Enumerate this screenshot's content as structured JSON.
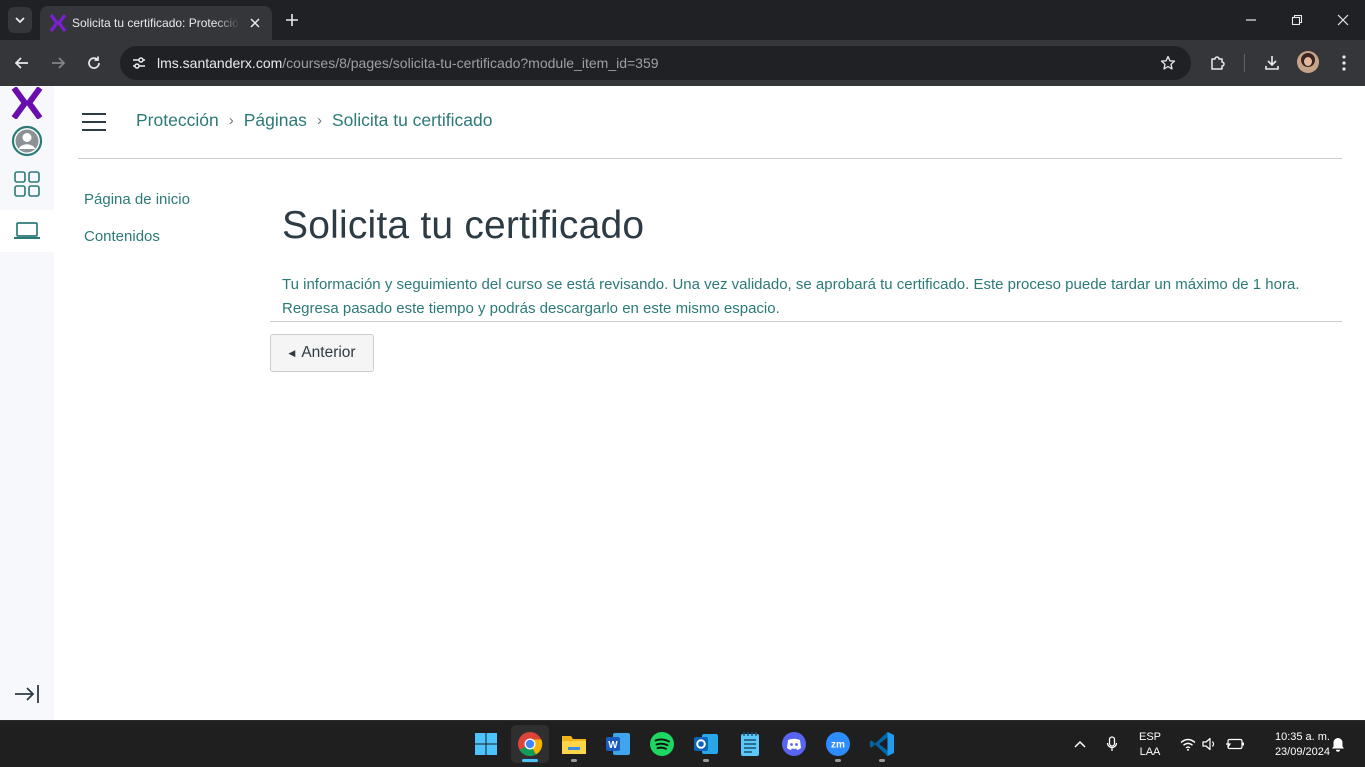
{
  "browser": {
    "tab": {
      "title": "Solicita tu certificado: Protección"
    },
    "url": {
      "host": "lms.santanderx.com",
      "path": "/courses/8/pages/solicita-tu-certificado?module_item_id=359"
    }
  },
  "lms": {
    "breadcrumb": [
      {
        "label": "Protección"
      },
      {
        "label": "Páginas"
      },
      {
        "label": "Solicita tu certificado"
      }
    ],
    "course_nav": [
      {
        "label": "Página de inicio"
      },
      {
        "label": "Contenidos"
      }
    ],
    "page": {
      "title": "Solicita tu certificado",
      "body": "Tu información y seguimiento del curso se está revisando. Una vez validado, se aprobará tu certificado. Este proceso puede tardar un máximo de 1 hora. Regresa pasado este tiempo y podrás descargarlo en este mismo espacio.",
      "prev_label": "Anterior"
    }
  },
  "taskbar": {
    "apps": [
      "windows-start",
      "chrome",
      "file-explorer",
      "word",
      "spotify",
      "outlook",
      "notepad",
      "discord",
      "zoom",
      "vscode"
    ],
    "language": {
      "line1": "ESP",
      "line2": "LAA"
    },
    "clock": {
      "time": "10:35 a. m.",
      "date": "23/09/2024"
    }
  },
  "colors": {
    "brand_purple": "#6a0dad",
    "link_teal": "#2b7a78",
    "chrome_dark": "#202124",
    "chrome_toolbar": "#35363a"
  }
}
